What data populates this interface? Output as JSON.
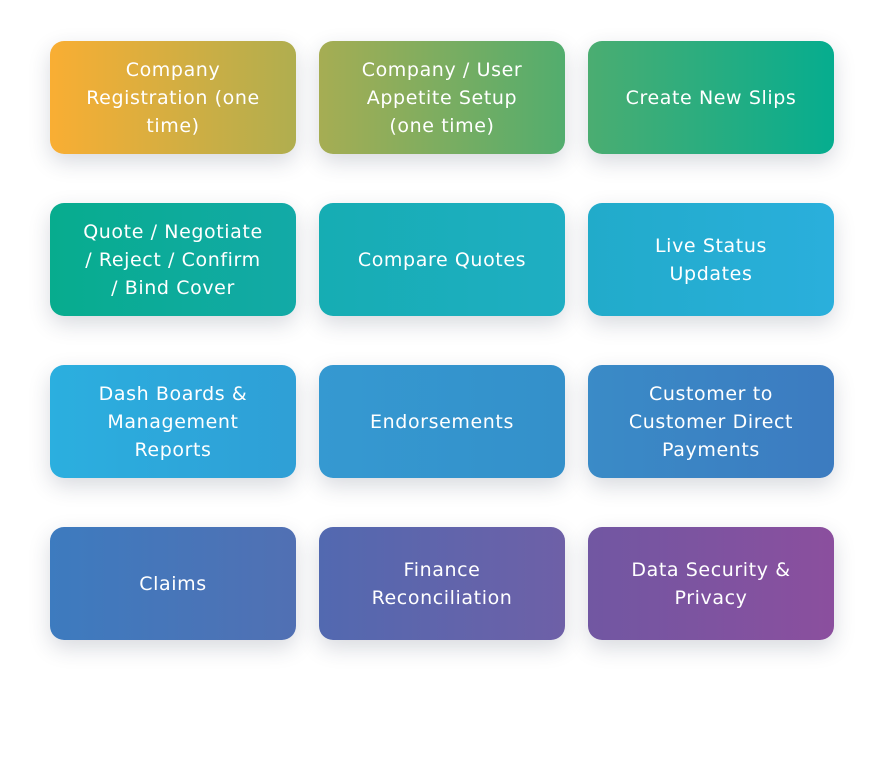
{
  "cards": [
    {
      "label": "Company\nRegistration (one\ntime)",
      "color_start": "#F9AE33",
      "color_end": "#B0AE4F"
    },
    {
      "label": "Company / User\nAppetite Setup\n(one time)",
      "color_start": "#A6AD53",
      "color_end": "#52AD6E"
    },
    {
      "label": "Create New Slips",
      "color_start": "#4BAD71",
      "color_end": "#06AD8F"
    },
    {
      "label": "Quote / Negotiate\n/ Reject / Confirm\n/ Bind Cover",
      "color_start": "#07AC8E",
      "color_end": "#13AAA7"
    },
    {
      "label": "Compare Quotes",
      "color_start": "#16ADB3",
      "color_end": "#1FAEC3"
    },
    {
      "label": "Live Status\nUpdates",
      "color_start": "#21ABCA",
      "color_end": "#2AAFDC"
    },
    {
      "label": "Dash Boards &\nManagement\nReports",
      "color_start": "#2BAFDF",
      "color_end": "#2F9FD6"
    },
    {
      "label": "Endorsements",
      "color_start": "#3599D1",
      "color_end": "#3490CA"
    },
    {
      "label": "Customer to\nCustomer Direct\nPayments",
      "color_start": "#3A8BC7",
      "color_end": "#3C7BC0"
    },
    {
      "label": "Claims",
      "color_start": "#3D7BBF",
      "color_end": "#5170B3"
    },
    {
      "label": "Finance\nReconciliation",
      "color_start": "#5269B0",
      "color_end": "#6E60A7"
    },
    {
      "label": "Data Security &\nPrivacy",
      "color_start": "#7157A2",
      "color_end": "#8B4F9E"
    }
  ]
}
